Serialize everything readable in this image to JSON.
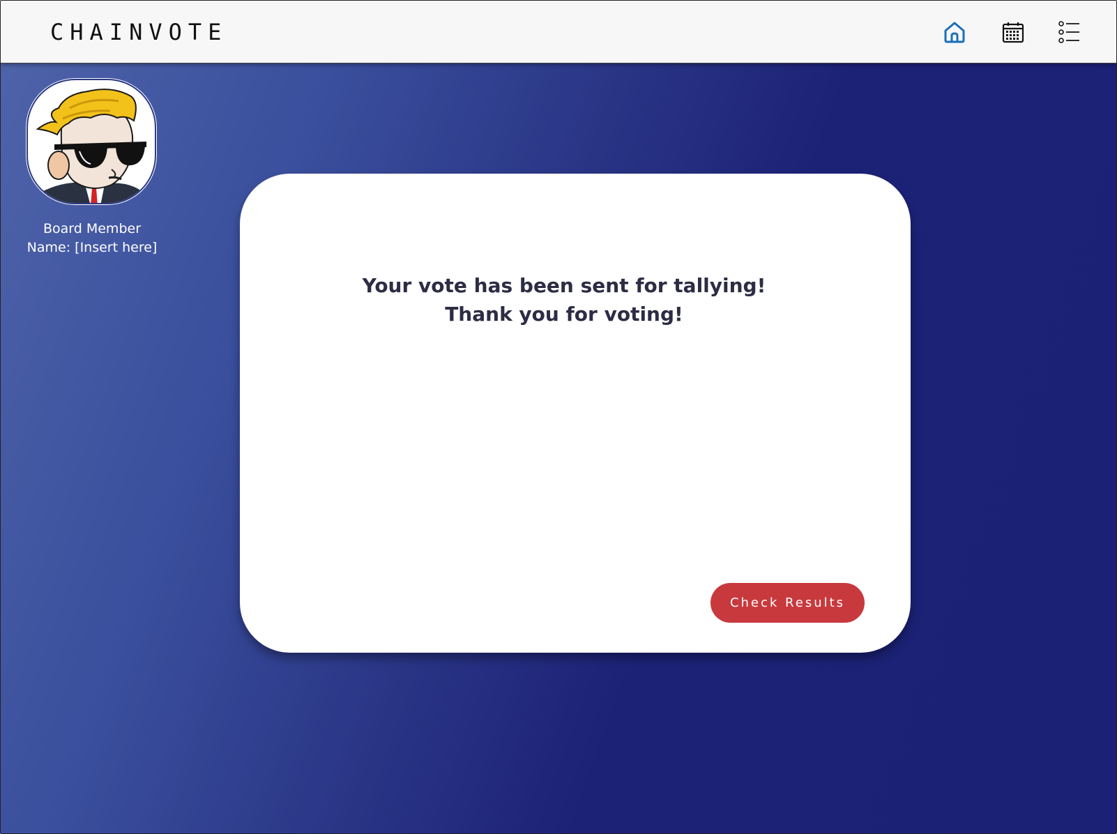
{
  "app": {
    "brand": "CHAINVOTE"
  },
  "nav": {
    "items": [
      {
        "icon": "home-icon",
        "active": true,
        "color": "#1a6fb8"
      },
      {
        "icon": "calendar-icon",
        "active": false,
        "color": "#111111"
      },
      {
        "icon": "list-icon",
        "active": false,
        "color": "#111111"
      }
    ]
  },
  "profile": {
    "avatar_icon": "avatar-sunglasses-character",
    "role": "Board Member",
    "name_line": "Name: [Insert here]"
  },
  "confirmation": {
    "line1": "Your vote has been sent for tallying!",
    "line2": "Thank you for voting!",
    "button_label": "Check Results"
  },
  "colors": {
    "accent_button": "#c8393d",
    "background_gradient_start": "#4f64a9",
    "background_gradient_end": "#1b2275",
    "card_text": "#2c2c44"
  }
}
